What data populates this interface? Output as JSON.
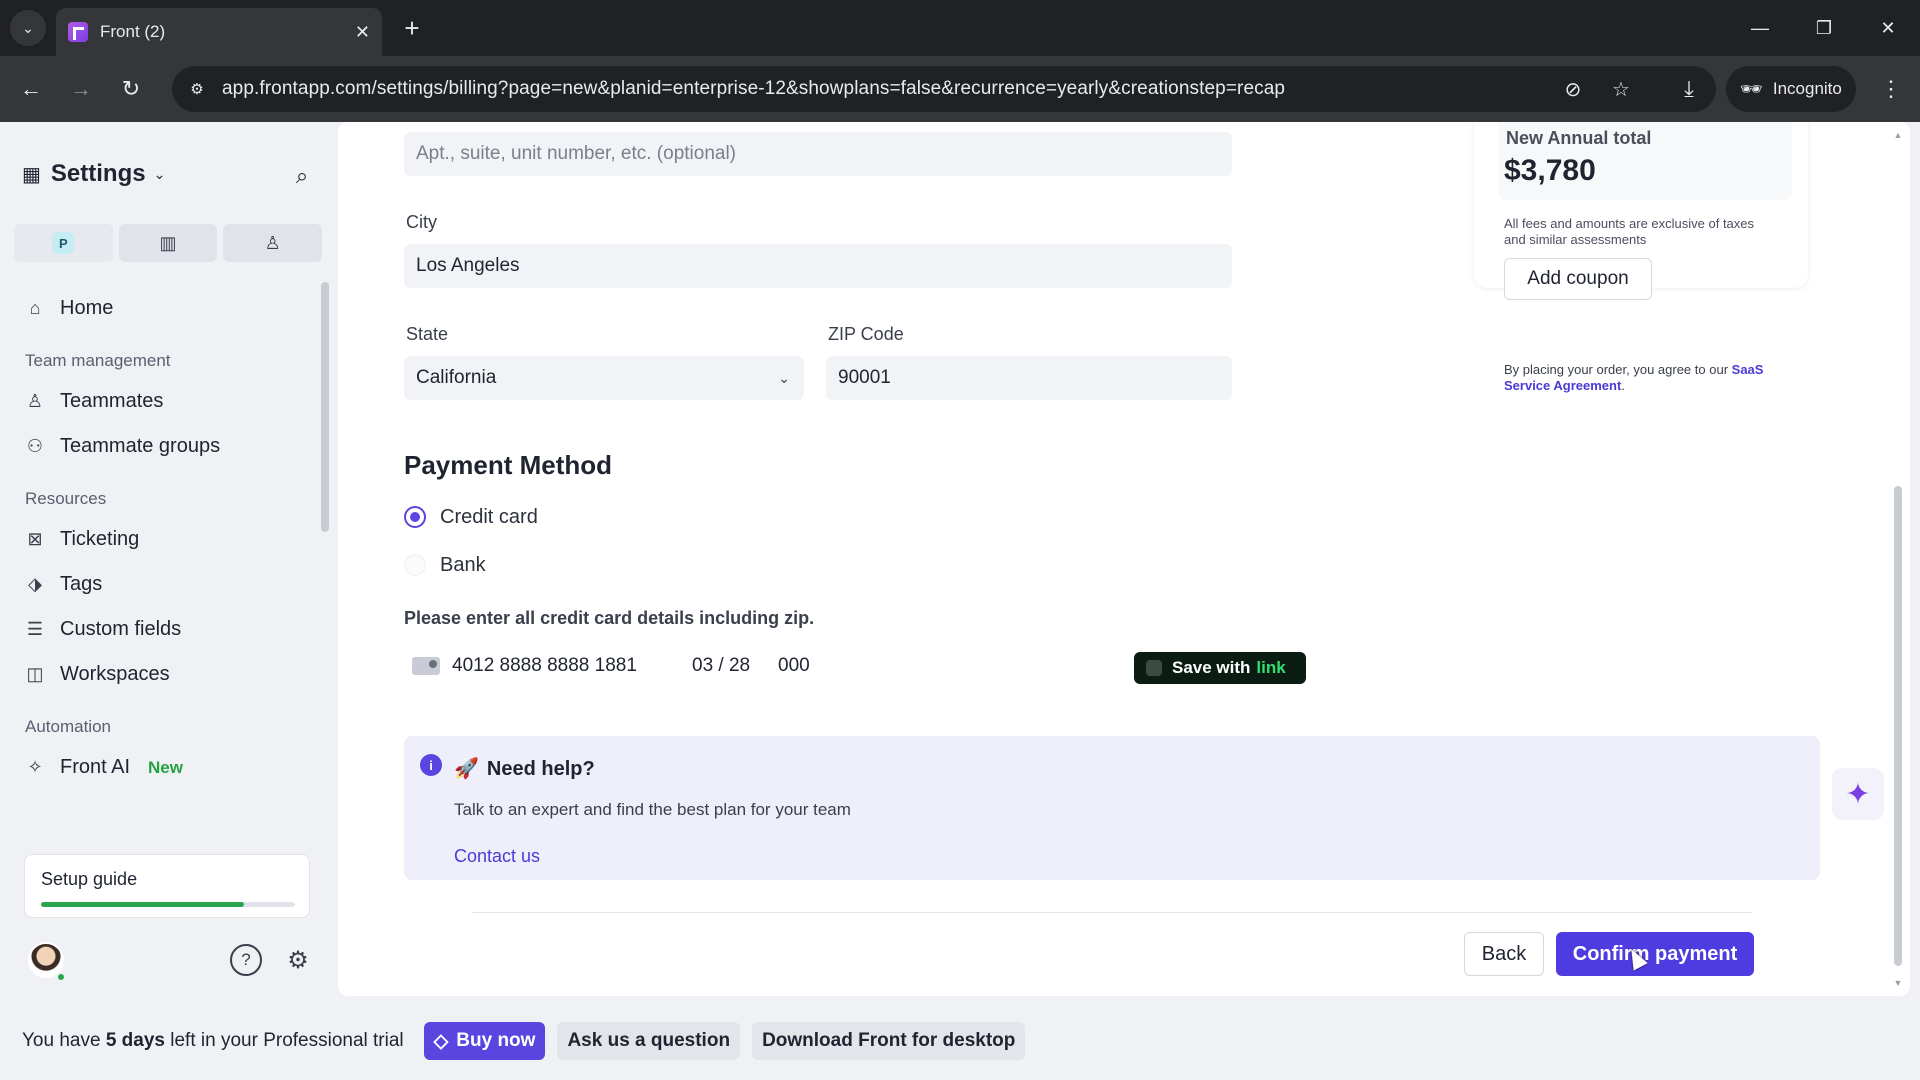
{
  "browser": {
    "tab_title": "Front (2)",
    "url": "app.frontapp.com/settings/billing?page=new&planid=enterprise-12&showplans=false&recurrence=yearly&creationstep=recap",
    "incognito_label": "Incognito"
  },
  "sidebar": {
    "title": "Settings",
    "workspace_initial": "P",
    "items": [
      {
        "label": "Home",
        "icon": "home-icon"
      },
      {
        "section": "Team management"
      },
      {
        "label": "Teammates",
        "icon": "person-icon"
      },
      {
        "label": "Teammate groups",
        "icon": "people-icon"
      },
      {
        "section": "Resources"
      },
      {
        "label": "Ticketing",
        "icon": "ticket-icon"
      },
      {
        "label": "Tags",
        "icon": "tag-icon"
      },
      {
        "label": "Custom fields",
        "icon": "fields-icon"
      },
      {
        "label": "Workspaces",
        "icon": "workspace-icon"
      },
      {
        "section": "Automation"
      },
      {
        "label": "Front AI",
        "icon": "sparkle-icon",
        "badge": "New"
      }
    ],
    "setup_guide": {
      "label": "Setup guide",
      "progress": 0.8
    }
  },
  "form": {
    "address2_placeholder": "Apt., suite, unit number, etc. (optional)",
    "city_label": "City",
    "city_value": "Los Angeles",
    "state_label": "State",
    "state_value": "California",
    "zip_label": "ZIP Code",
    "zip_value": "90001"
  },
  "payment": {
    "title": "Payment Method",
    "options": [
      {
        "label": "Credit card",
        "selected": true
      },
      {
        "label": "Bank",
        "selected": false
      }
    ],
    "note": "Please enter all credit card details including zip.",
    "card_number": "4012 8888 8888 1881",
    "card_expiry": "03 / 28",
    "card_cvc": "000",
    "save_with": "Save with",
    "save_brand": "link"
  },
  "help": {
    "title": "Need help?",
    "subtitle": "Talk to an expert and find the best plan for your team",
    "link": "Contact us"
  },
  "summary": {
    "label": "New Annual total",
    "total": "$3,780",
    "note": "All fees and amounts are exclusive of taxes and similar assessments",
    "coupon_button": "Add coupon",
    "agree_text": "By placing your order, you agree to our",
    "agree_link": "SaaS Service Agreement",
    "agree_end": "."
  },
  "actions": {
    "back": "Back",
    "confirm": "Confirm payment"
  },
  "trial": {
    "prefix": "You have ",
    "days": "5 days",
    "suffix": " left in your Professional trial",
    "buy": "Buy now",
    "ask": "Ask us a question",
    "download": "Download Front for desktop"
  },
  "colors": {
    "accent": "#4f3ce0",
    "link_brand": "#33dd70",
    "progress": "#2aa44f"
  }
}
